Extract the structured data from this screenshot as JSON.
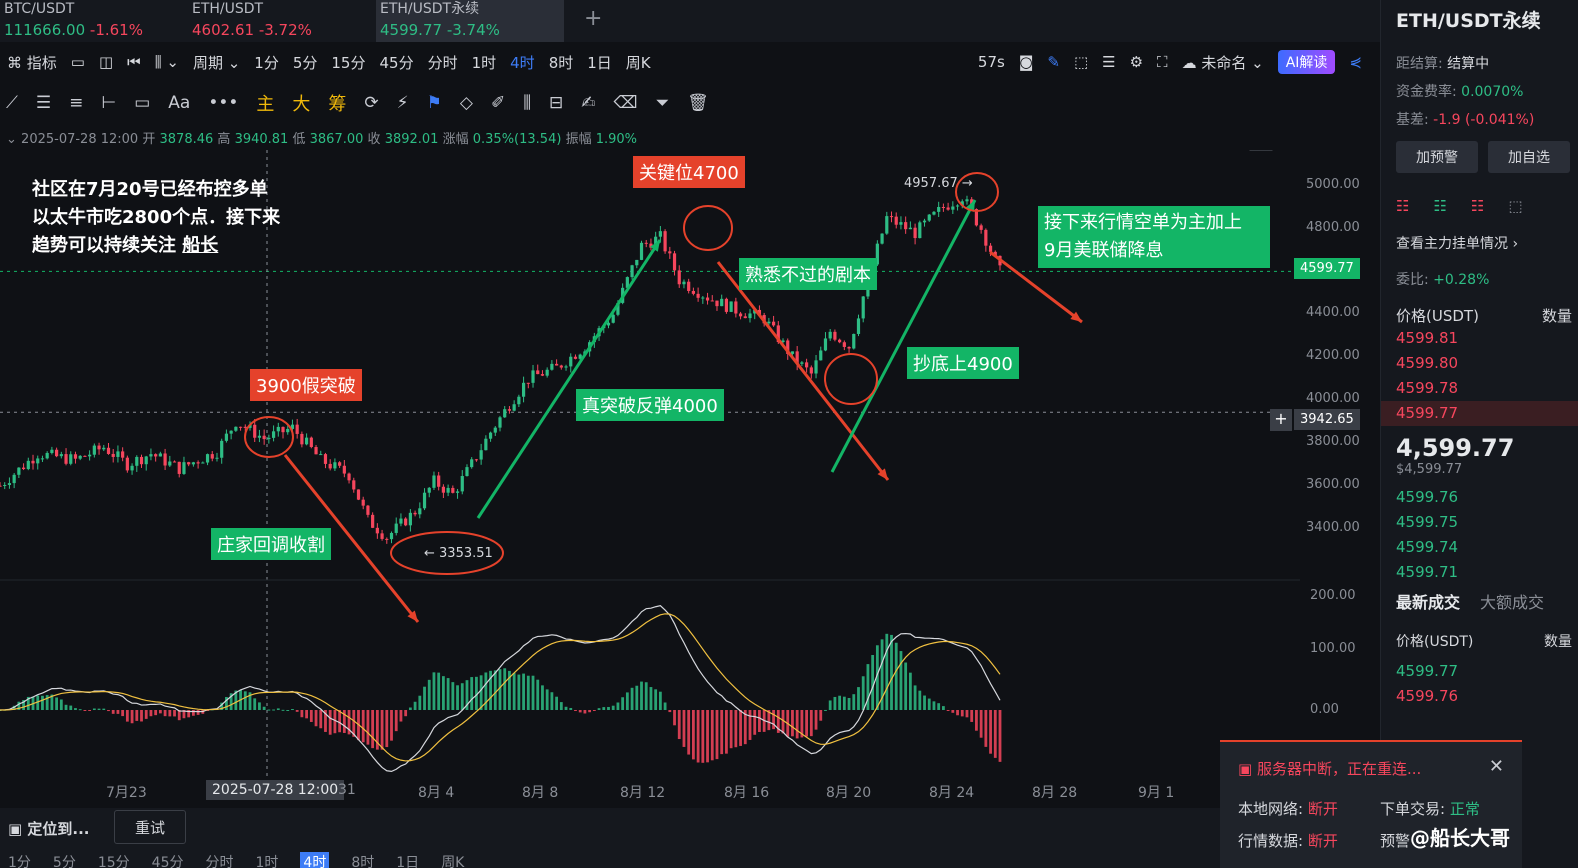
{
  "tabs": [
    {
      "symbol": "BTC/USDT",
      "price": "111666.00",
      "change": "-1.61%",
      "price_color": "up",
      "change_color": "dn"
    },
    {
      "symbol": "ETH/USDT",
      "price": "4602.61",
      "change": "-3.72%",
      "price_color": "dn",
      "change_color": "dn"
    },
    {
      "symbol": "ETH/USDT永续",
      "price": "4599.77",
      "change": "-3.74%",
      "price_color": "up",
      "change_color": "up"
    }
  ],
  "toolbar1": {
    "indicator": "指标",
    "period": "周期",
    "timeframes": [
      "1分",
      "5分",
      "15分",
      "45分",
      "分时",
      "1时",
      "4时",
      "8时",
      "1日",
      "周K"
    ],
    "active_timeframe": "4时",
    "countdown": "57s",
    "layout_name": "未命名",
    "ai_label": "AI解读"
  },
  "toolbar2": {
    "text_tool": "Aa",
    "more": "•••",
    "orange": [
      "主",
      "大",
      "筹"
    ]
  },
  "ohlc": {
    "date": "2025-07-28 12:00",
    "open_label": "开",
    "open": "3878.46",
    "high_label": "高",
    "high": "3940.81",
    "low_label": "低",
    "low": "3867.00",
    "close_label": "收",
    "close": "3892.01",
    "change_label": "涨幅",
    "change": "0.35%(13.54)",
    "amp_label": "振幅",
    "amp": "1.90%"
  },
  "annotations": {
    "intro_line1": "社区在7月20号已经布控多单",
    "intro_line2": "以太牛市吃2800个点．接下来",
    "intro_line3": "趋势可以持续关注",
    "intro_author": "船长",
    "fake_break": "3900假突破",
    "key_level": "关键位4700",
    "familiar": "熟悉不过的剧本",
    "true_break": "真突破反弹4000",
    "bottom_fish": "抄底上4900",
    "harvest": "庄家回调收割",
    "next_line1": "接下来行情空单为主加上",
    "next_line2": "9月美联储降息",
    "high_mark": "4957.67",
    "low_mark": "3353.51"
  },
  "price_labels": {
    "current": "4599.77",
    "crosshair": "3942.65"
  },
  "chart_data": {
    "type": "candlestick",
    "yticks": [
      "5000.00",
      "4800.00",
      "4600.00",
      "4400.00",
      "4200.00",
      "4000.00",
      "3800.00",
      "3600.00",
      "3400.00"
    ],
    "macd_ticks": [
      "200.00",
      "100.00",
      "0.00"
    ],
    "xticks": [
      "7月23",
      "2025-07-28 12:00",
      "31",
      "8月 4",
      "8月 8",
      "8月 12",
      "8月 16",
      "8月 20",
      "8月 24",
      "8月 28",
      "9月 1"
    ],
    "ylim": [
      3300,
      5050
    ],
    "path": [
      [
        0,
        3600
      ],
      [
        8,
        3750
      ],
      [
        16,
        3720
      ],
      [
        22,
        3780
      ],
      [
        27,
        3700
      ],
      [
        32,
        3750
      ],
      [
        38,
        3680
      ],
      [
        46,
        3760
      ],
      [
        50,
        3900
      ],
      [
        56,
        3820
      ],
      [
        62,
        3870
      ],
      [
        68,
        3720
      ],
      [
        74,
        3650
      ],
      [
        78,
        3440
      ],
      [
        82,
        3360
      ],
      [
        88,
        3480
      ],
      [
        92,
        3620
      ],
      [
        96,
        3560
      ],
      [
        100,
        3700
      ],
      [
        104,
        3850
      ],
      [
        108,
        3980
      ],
      [
        112,
        4100
      ],
      [
        118,
        4150
      ],
      [
        124,
        4250
      ],
      [
        130,
        4400
      ],
      [
        136,
        4720
      ],
      [
        140,
        4760
      ],
      [
        144,
        4560
      ],
      [
        150,
        4480
      ],
      [
        156,
        4420
      ],
      [
        162,
        4380
      ],
      [
        168,
        4200
      ],
      [
        172,
        4120
      ],
      [
        176,
        4320
      ],
      [
        180,
        4250
      ],
      [
        184,
        4560
      ],
      [
        188,
        4850
      ],
      [
        194,
        4780
      ],
      [
        200,
        4900
      ],
      [
        204,
        4950
      ],
      [
        208,
        4800
      ],
      [
        212,
        4600
      ]
    ]
  },
  "right_panel": {
    "title": "ETH/USDT永续",
    "settle_label": "距结算:",
    "settle_value": "结算中",
    "funding_label": "资金费率:",
    "funding_value": "0.0070%",
    "basis_label": "基差:",
    "basis_value": "-1.9 (-0.041%)",
    "alert_btn": "加预警",
    "fav_btn": "加自选",
    "orders_link": "查看主力挂单情况",
    "ratio_label": "委比:",
    "ratio_value": "+0.28%",
    "price_header": "价格(USDT)",
    "qty_header": "数量",
    "asks": [
      "4599.81",
      "4599.80",
      "4599.78",
      "4599.77"
    ],
    "last_price": "4,599.77",
    "last_usd": "$4,599.77",
    "bids": [
      "4599.76",
      "4599.75",
      "4599.74",
      "4599.71"
    ],
    "trades_tab": "最新成交",
    "big_trades_tab": "大额成交",
    "trades_price_header": "价格(USDT)",
    "trades_qty_header": "数量",
    "trades": [
      {
        "price": "4599.77",
        "color": "green"
      },
      {
        "price": "4599.76",
        "color": "red"
      }
    ]
  },
  "bottom": {
    "locate": "定位到...",
    "retry": "重试",
    "periods": [
      "1分",
      "5分",
      "15分",
      "45分",
      "分时",
      "1时",
      "4时",
      "8时",
      "1日",
      "周K"
    ]
  },
  "popup": {
    "header": "服务器中断，正在重连...",
    "local_net_label": "本地网络:",
    "local_net_value": "断开",
    "trade_label": "下单交易:",
    "trade_value": "正常",
    "market_label": "行情数据:",
    "market_value": "断开",
    "alert_label": "预警"
  },
  "watermark": "@船长大哥"
}
